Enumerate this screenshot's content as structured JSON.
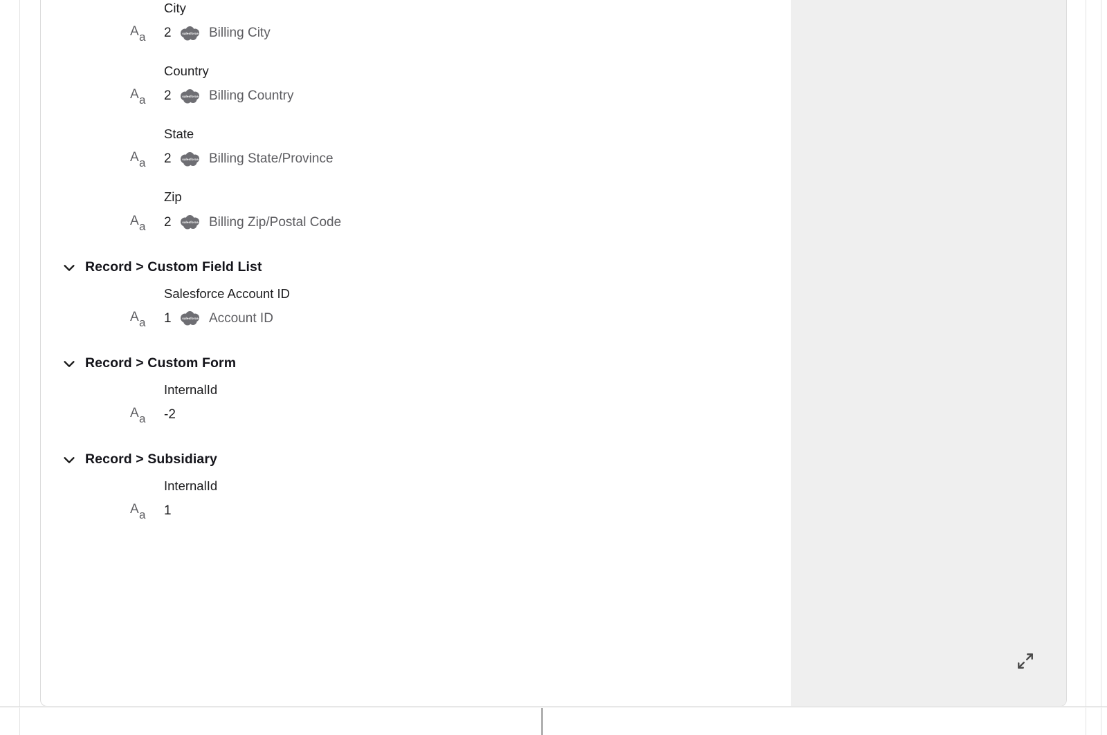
{
  "panel": {
    "name": "field-mapping-panel",
    "icon_labels": {
      "text_type": "Aa",
      "salesforce_badge": "salesforce",
      "collapse_chevron": "chevron-down",
      "expand_panel": "expand-diagonal"
    }
  },
  "colors": {
    "label_text": "#1d1d1f",
    "value_text": "#5c5c60",
    "group_title": "#14141a",
    "badge_gray": "#6e6e73",
    "panel_gray": "#efefef",
    "card_border": "#dcdcdc"
  },
  "groups": [
    {
      "title": "",
      "has_header": false,
      "fields": [
        {
          "label": "City",
          "count": "2",
          "badge": "salesforce",
          "value": "Billing City"
        },
        {
          "label": "Country",
          "count": "2",
          "badge": "salesforce",
          "value": "Billing Country"
        },
        {
          "label": "State",
          "count": "2",
          "badge": "salesforce",
          "value": "Billing State/Province"
        },
        {
          "label": "Zip",
          "count": "2",
          "badge": "salesforce",
          "value": "Billing Zip/Postal Code"
        }
      ]
    },
    {
      "title": "Record > Custom Field List",
      "has_header": true,
      "fields": [
        {
          "label": "Salesforce Account ID",
          "count": "1",
          "badge": "salesforce",
          "value": "Account ID"
        }
      ]
    },
    {
      "title": "Record > Custom Form",
      "has_header": true,
      "fields": [
        {
          "label": "InternalId",
          "count": "-2",
          "badge": null,
          "value": ""
        }
      ]
    },
    {
      "title": "Record > Subsidiary",
      "has_header": true,
      "fields": [
        {
          "label": "InternalId",
          "count": "1",
          "badge": null,
          "value": ""
        }
      ]
    }
  ]
}
